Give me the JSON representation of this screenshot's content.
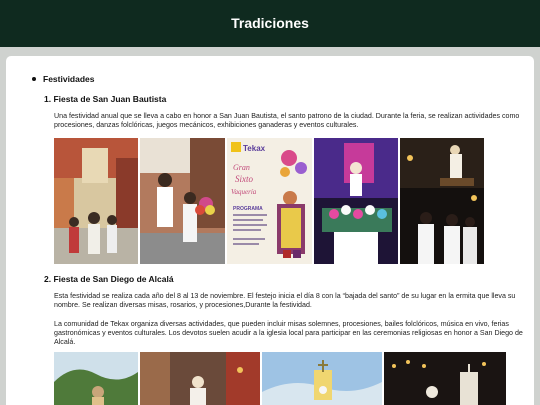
{
  "header": {
    "title": "Tradiciones"
  },
  "section": {
    "title": "Festividades"
  },
  "items": [
    {
      "heading": "1. Fiesta de San Juan Bautista",
      "paragraphs": [
        "Una festividad anual que se lleva a cabo en honor a San Juan Bautista, el santo patrono de la ciudad. Durante la feria, se realizan actividades como procesiones, danzas folclóricas, juegos mecánicos, exhibiciones ganaderas y eventos culturales."
      ]
    },
    {
      "heading": "2. Fiesta de San Diego de Alcalá",
      "paragraphs": [
        "Esta festividad se realiza cada año del 8 al 13 de noviembre. El festejo inicia el día 8 con la “bajada del santo” de su lugar en la ermita que lleva su nombre. Se realizan diversas misas, rosarios, y procesiones,Durante la festividad.",
        "La comunidad de Tekax organiza diversas actividades, que pueden incluir misas solemnes, procesiones, bailes folclóricos, música en vivo, ferias gastronómicas y eventos culturales. Los devotos suelen acudir a la iglesia local para participar en las ceremonias religiosas en honor a San Diego de Alcalá."
      ]
    }
  ],
  "poster": {
    "brand": "Tekax",
    "title_line1": "Gran",
    "title_line2": "Sixto",
    "title_line3": "Vaquería",
    "program": "PROGRAMA"
  },
  "colors": {
    "topbar": "#0f2a1f",
    "background": "#cfd2cf",
    "card": "#ffffff"
  }
}
